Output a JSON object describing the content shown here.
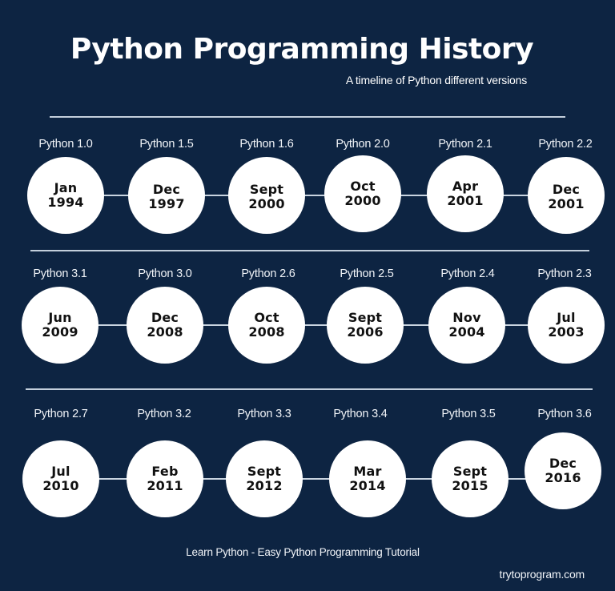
{
  "header": {
    "title": "Python Programming History",
    "subtitle": "A timeline of Python different versions"
  },
  "colors": {
    "background": "#0d2442",
    "circle": "#ffffff",
    "text_light": "#ffffff",
    "text_dark": "#111111",
    "line": "#c3cfdc"
  },
  "rows": [
    {
      "releases": [
        {
          "version": "Python 1.0",
          "month": "Jan",
          "year": "1994"
        },
        {
          "version": "Python 1.5",
          "month": "Dec",
          "year": "1997"
        },
        {
          "version": "Python 1.6",
          "month": "Sept",
          "year": "2000"
        },
        {
          "version": "Python 2.0",
          "month": "Oct",
          "year": "2000"
        },
        {
          "version": "Python 2.1",
          "month": "Apr",
          "year": "2001"
        },
        {
          "version": "Python 2.2",
          "month": "Dec",
          "year": "2001"
        }
      ]
    },
    {
      "releases": [
        {
          "version": "Python 3.1",
          "month": "Jun",
          "year": "2009"
        },
        {
          "version": "Python 3.0",
          "month": "Dec",
          "year": "2008"
        },
        {
          "version": "Python 2.6",
          "month": "Oct",
          "year": "2008"
        },
        {
          "version": "Python 2.5",
          "month": "Sept",
          "year": "2006"
        },
        {
          "version": "Python 2.4",
          "month": "Nov",
          "year": "2004"
        },
        {
          "version": "Python 2.3",
          "month": "Jul",
          "year": "2003"
        }
      ]
    },
    {
      "releases": [
        {
          "version": "Python 2.7",
          "month": "Jul",
          "year": "2010"
        },
        {
          "version": "Python 3.2",
          "month": "Feb",
          "year": "2011"
        },
        {
          "version": "Python 3.3",
          "month": "Sept",
          "year": "2012"
        },
        {
          "version": "Python 3.4",
          "month": "Mar",
          "year": "2014"
        },
        {
          "version": "Python 3.5",
          "month": "Sept",
          "year": "2015"
        },
        {
          "version": "Python 3.6",
          "month": "Dec",
          "year": "2016"
        }
      ]
    }
  ],
  "footer": {
    "tagline": "Learn Python - Easy Python Programming Tutorial",
    "site": "trytoprogram.com"
  }
}
